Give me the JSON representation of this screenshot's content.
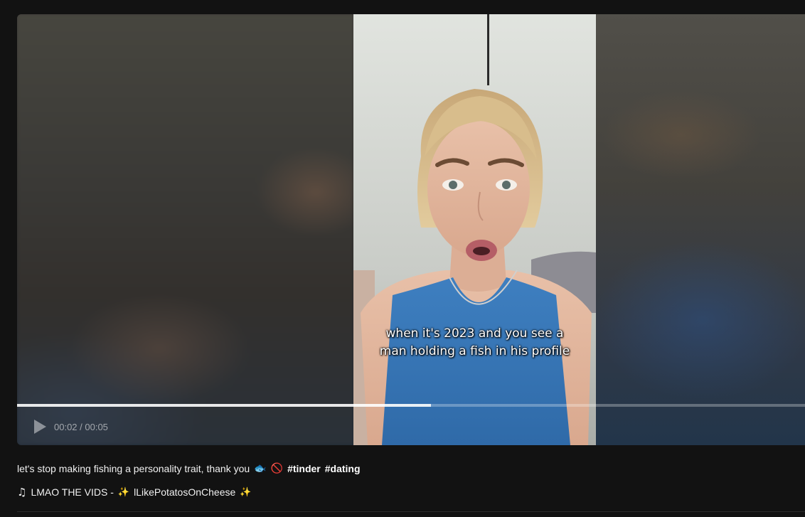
{
  "video": {
    "caption": "when it's 2023 and you see a man holding a fish in his profile",
    "current_time": "00:02",
    "duration": "00:05",
    "time_display": "00:02 / 00:05",
    "progress": 0.525
  },
  "post": {
    "description": "let's stop making fishing a personality trait, thank you",
    "emojis": [
      "🐟",
      "🚫"
    ],
    "hashtags": [
      "#tinder",
      "#dating"
    ]
  },
  "music": {
    "note_icon": "♫",
    "prefix": "LMAO THE VIDS -",
    "sparkle": "✨",
    "artist": "lLikePotatosOnCheese",
    "sparkle_end": "✨"
  },
  "icons": {
    "play": "play-icon",
    "music": "music-note-icon"
  }
}
